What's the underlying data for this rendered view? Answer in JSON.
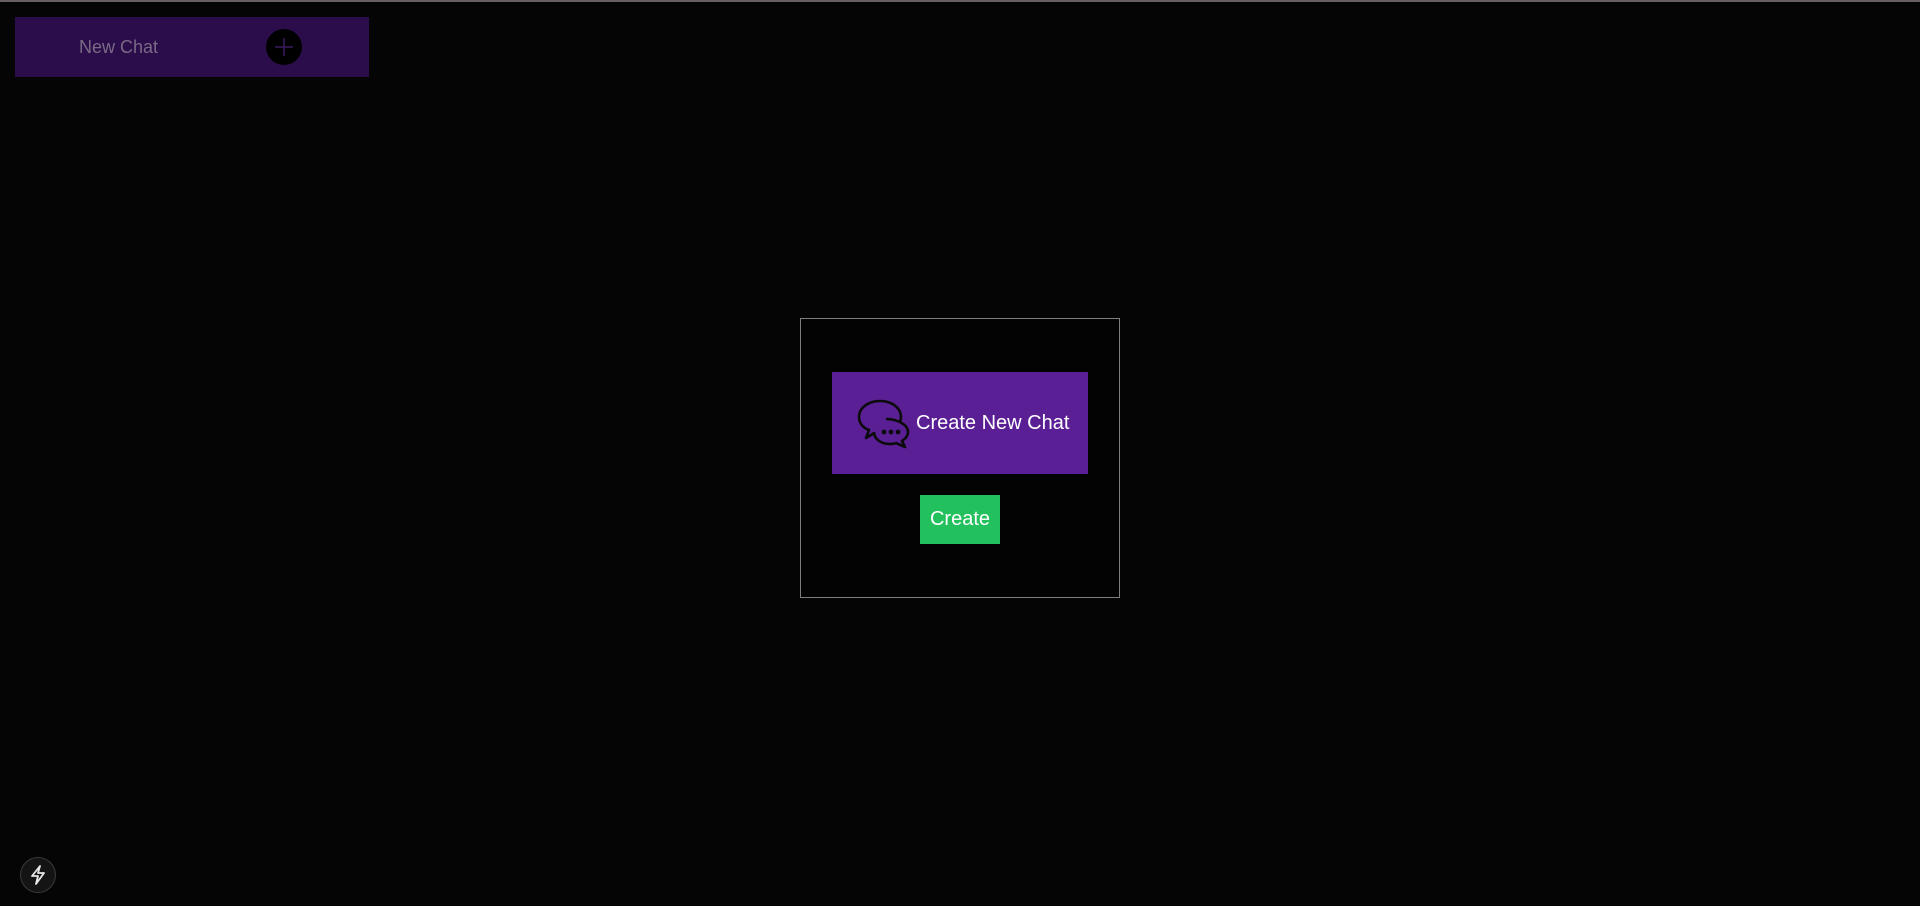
{
  "sidebar": {
    "new_chat_label": "New Chat",
    "add_icon": "plus-icon"
  },
  "modal": {
    "header_label": "Create New Chat",
    "header_icon": "chat-bubbles-icon",
    "create_label": "Create"
  },
  "corner": {
    "icon": "lightning-icon"
  },
  "colors": {
    "background": "#050505",
    "sidebar_bar": "#2a0d4a",
    "modal_header": "#5b1f95",
    "create_button": "#22c15e",
    "modal_border": "#7d7d7d"
  }
}
